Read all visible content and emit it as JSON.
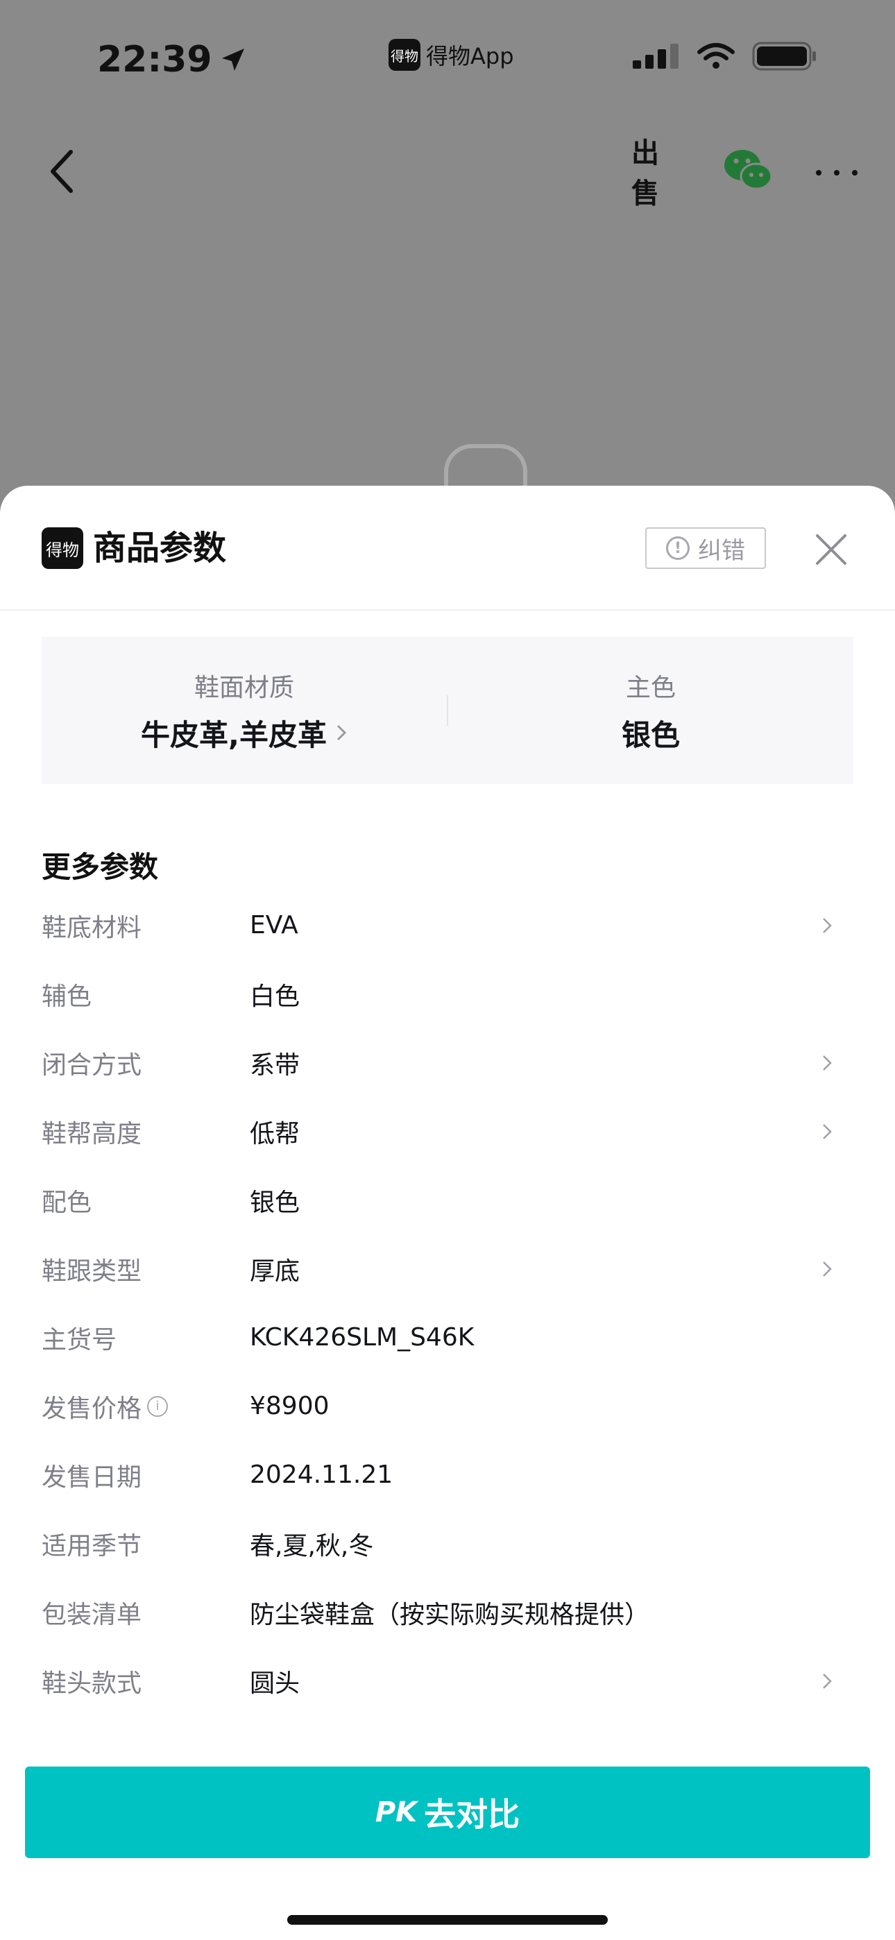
{
  "status_bar": {
    "time": "22:39",
    "carrier_logo_text": "得物",
    "carrier_app": "得物App"
  },
  "header": {
    "sell_label": "出售"
  },
  "sheet": {
    "logo_text": "得物",
    "title": "商品参数",
    "report_label": "纠错",
    "summary": [
      {
        "label": "鞋面材质",
        "value": "牛皮革,羊皮革",
        "has_arrow": true
      },
      {
        "label": "主色",
        "value": "银色",
        "has_arrow": false
      }
    ],
    "more_title": "更多参数",
    "params": [
      {
        "label": "鞋底材料",
        "value": "EVA",
        "has_arrow": true
      },
      {
        "label": "辅色",
        "value": "白色",
        "has_arrow": false
      },
      {
        "label": "闭合方式",
        "value": "系带",
        "has_arrow": true
      },
      {
        "label": "鞋帮高度",
        "value": "低帮",
        "has_arrow": true
      },
      {
        "label": "配色",
        "value": "银色",
        "has_arrow": false
      },
      {
        "label": "鞋跟类型",
        "value": "厚底",
        "has_arrow": true
      },
      {
        "label": "主货号",
        "value": "KCK426SLM_S46K",
        "has_arrow": false
      },
      {
        "label": "发售价格",
        "value": "¥8900",
        "has_arrow": false,
        "has_info": true
      },
      {
        "label": "发售日期",
        "value": "2024.11.21",
        "has_arrow": false
      },
      {
        "label": "适用季节",
        "value": "春,夏,秋,冬",
        "has_arrow": false
      },
      {
        "label": "包装清单",
        "value": "防尘袋鞋盒（按实际购买规格提供）",
        "has_arrow": false
      },
      {
        "label": "鞋头款式",
        "value": "圆头",
        "has_arrow": true
      }
    ],
    "pk_prefix": "PK",
    "pk_label": "去对比"
  },
  "colors": {
    "accent": "#01c2c3",
    "overlay": "#8a8a8a",
    "label_gray": "#7f7f8a"
  },
  "icons": {
    "back": "chevron-left-icon",
    "wechat": "wechat-icon",
    "more": "more-dots-icon",
    "close": "close-icon",
    "report": "exclamation-circle-icon",
    "row_arrow": "chevron-right-icon",
    "info": "info-icon"
  }
}
